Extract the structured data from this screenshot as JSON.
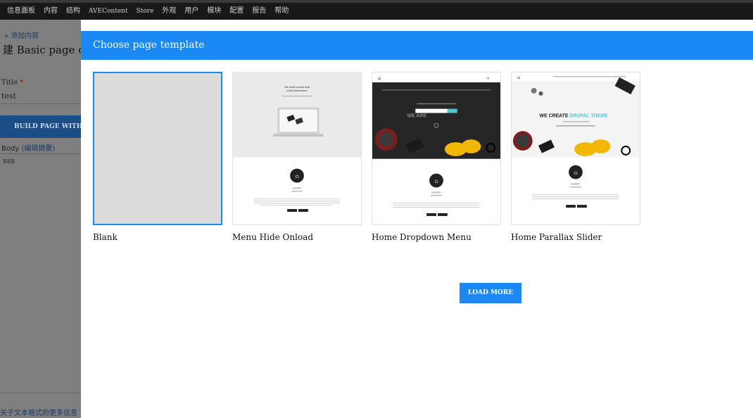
{
  "topbar": {
    "items": [
      "信息面板",
      "内容",
      "结构",
      "AVEContent",
      "Store",
      "外观",
      "用户",
      "模块",
      "配置",
      "报告",
      "帮助"
    ]
  },
  "underlying": {
    "breadcrumb": "» 添加内容",
    "page_title": "建 Basic page c",
    "title_label": "Title",
    "title_required": "*",
    "title_value": "test",
    "build_button": "BUILD PAGE WITH A",
    "body_label": "Body",
    "body_summary_link": "(编辑摘要)",
    "body_value": "sss",
    "footer_link": "关于文本格式的更多信息"
  },
  "modal": {
    "title": "Choose page template",
    "templates": [
      {
        "label": "Blank",
        "selected": true
      },
      {
        "label": "Menu Hide Onload",
        "selected": false,
        "headline": "We build brands that build businesses",
        "section": "HISTORY"
      },
      {
        "label": "Home Dropdown Menu",
        "selected": false,
        "headline": "WE ARE",
        "section": "HISTORY"
      },
      {
        "label": "Home Parallax Slider",
        "selected": false,
        "headline_main": "WE CREATE ",
        "headline_accent": "DRUPAL THEME",
        "section": "HISTORY"
      }
    ],
    "load_more": "LOAD MORE"
  },
  "colors": {
    "accent": "#1a88f5",
    "topbar": "#181818",
    "overlay": "#7f7f7f",
    "drupal_accent": "#4fc8d8"
  }
}
